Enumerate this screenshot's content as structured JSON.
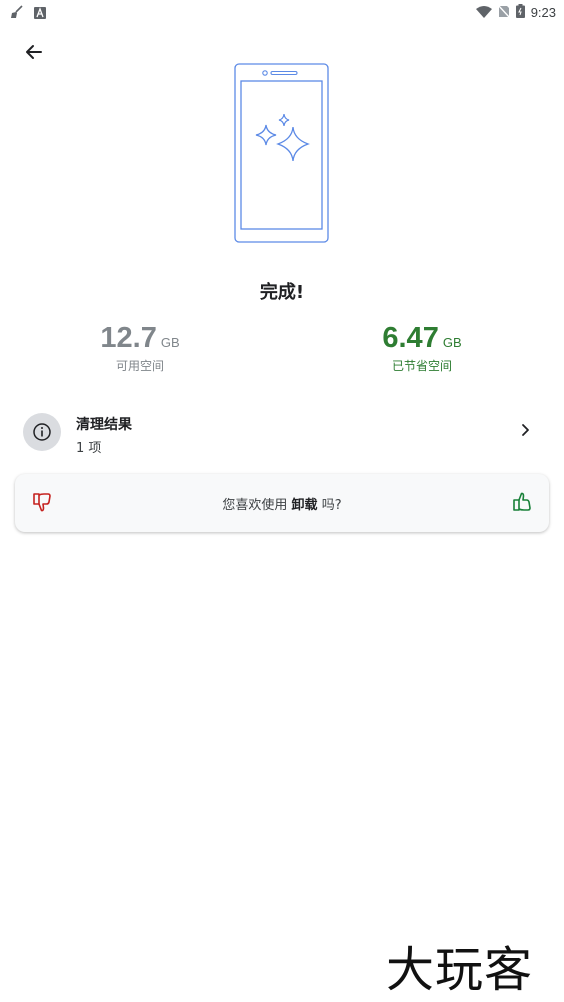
{
  "status_bar": {
    "time": "9:23",
    "left_icons": [
      "broom-icon",
      "a-box-icon"
    ],
    "right_icons": [
      "wifi-icon",
      "no-sim-icon",
      "battery-icon"
    ]
  },
  "header": {
    "back_icon": "arrow-left-icon"
  },
  "result": {
    "title": "完成!",
    "available": {
      "value": "12.7",
      "unit": "GB",
      "label": "可用空间"
    },
    "saved": {
      "value": "6.47",
      "unit": "GB",
      "label": "已节省空间"
    }
  },
  "cleanup": {
    "title": "清理结果",
    "count": "1 项"
  },
  "feedback": {
    "prefix": "您喜欢使用",
    "app_name": "卸载",
    "suffix": "吗?"
  },
  "colors": {
    "accent_green": "#2e7d32",
    "gray_text": "#80868b",
    "thumb_down": "#c5221f",
    "thumb_up": "#188038",
    "illustration_blue": "#5c8ae6"
  },
  "watermark": "大玩客"
}
